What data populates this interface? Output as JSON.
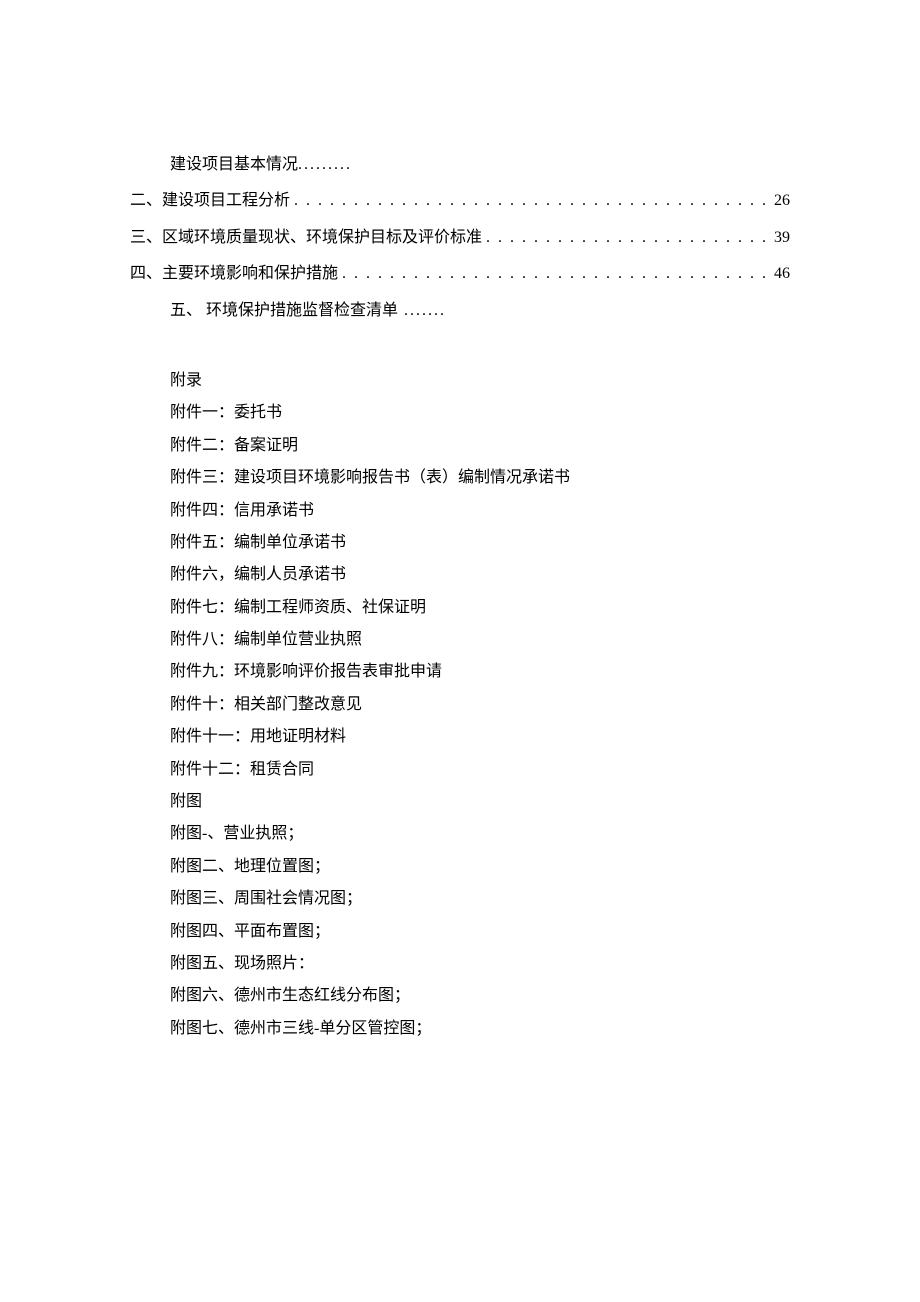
{
  "toc": {
    "item1": {
      "label": "建设项目基本情况",
      "dots": "........."
    },
    "item2": {
      "prefix": "二、",
      "label": "建设项目工程分析",
      "page": "26"
    },
    "item3": {
      "prefix": "三、",
      "label": "区域环境质量现状、环境保护目标及评价标准",
      "page": "39"
    },
    "item4": {
      "prefix": "四、",
      "label": "主要环境影响和保护措施",
      "page": "46"
    },
    "item5": {
      "prefix": "五、",
      "label": " 环境保护措施监督检查清单",
      "dots": " ......."
    }
  },
  "appendix": {
    "heading": "附录",
    "files": {
      "f1": "附件一：委托书",
      "f2": "附件二：备案证明",
      "f3": "附件三：建设项目环境影响报告书（表）编制情况承诺书",
      "f4": "附件四：信用承诺书",
      "f5": "附件五：编制单位承诺书",
      "f6": "附件六，编制人员承诺书",
      "f7": "附件七：编制工程师资质、社保证明",
      "f8": "附件八：编制单位营业执照",
      "f9": "附件九：环境影响评价报告表审批申请",
      "f10": "附件十：相关部门整改意见",
      "f11": "附件十一：用地证明材料",
      "f12": "附件十二：租赁合同"
    },
    "figures_heading": "附图",
    "figures": {
      "g1": "附图-、营业执照；",
      "g2": "附图二、地理位置图；",
      "g3": "附图三、周围社会情况图；",
      "g4": "附图四、平面布置图；",
      "g5": "附图五、现场照片：",
      "g6": "附图六、德州市生态红线分布图；",
      "g7": "附图七、德州市三线-单分区管控图；"
    }
  },
  "dots_fill": ". . . . . . . . . . . . . . . . . . . . . . . . . . . . . . . . . . . . . . . . . . . . . . . . . . . . . . . . . . . . . . . . . . . . . . . . . . . . . . . . . . . . . . . . . . . . . . . . . . . ."
}
